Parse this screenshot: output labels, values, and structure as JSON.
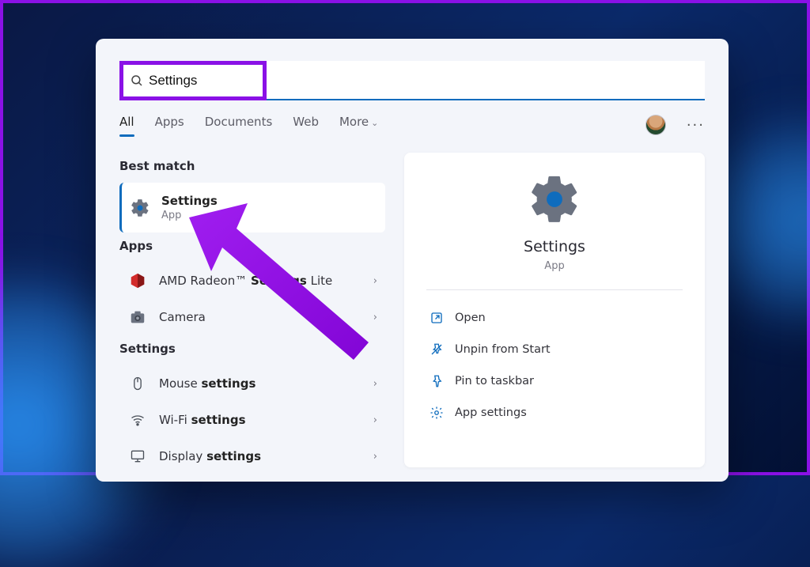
{
  "search": {
    "value": "Settings"
  },
  "tabs": {
    "all": "All",
    "apps": "Apps",
    "documents": "Documents",
    "web": "Web",
    "more": "More"
  },
  "sections": {
    "best_match": "Best match",
    "apps": "Apps",
    "settings": "Settings"
  },
  "best": {
    "title": "Settings",
    "subtitle": "App"
  },
  "apps_results": {
    "amd_pre": "AMD Radeon™ ",
    "amd_bold": "Settings",
    "amd_post": " Lite",
    "camera": "Camera"
  },
  "settings_results": {
    "mouse_pre": "Mouse ",
    "mouse_bold": "settings",
    "wifi_pre": "Wi-Fi ",
    "wifi_bold": "settings",
    "display_pre": "Display ",
    "display_bold": "settings"
  },
  "preview": {
    "title": "Settings",
    "subtitle": "App"
  },
  "actions": {
    "open": "Open",
    "unpin": "Unpin from Start",
    "pin_taskbar": "Pin to taskbar",
    "app_settings": "App settings"
  }
}
